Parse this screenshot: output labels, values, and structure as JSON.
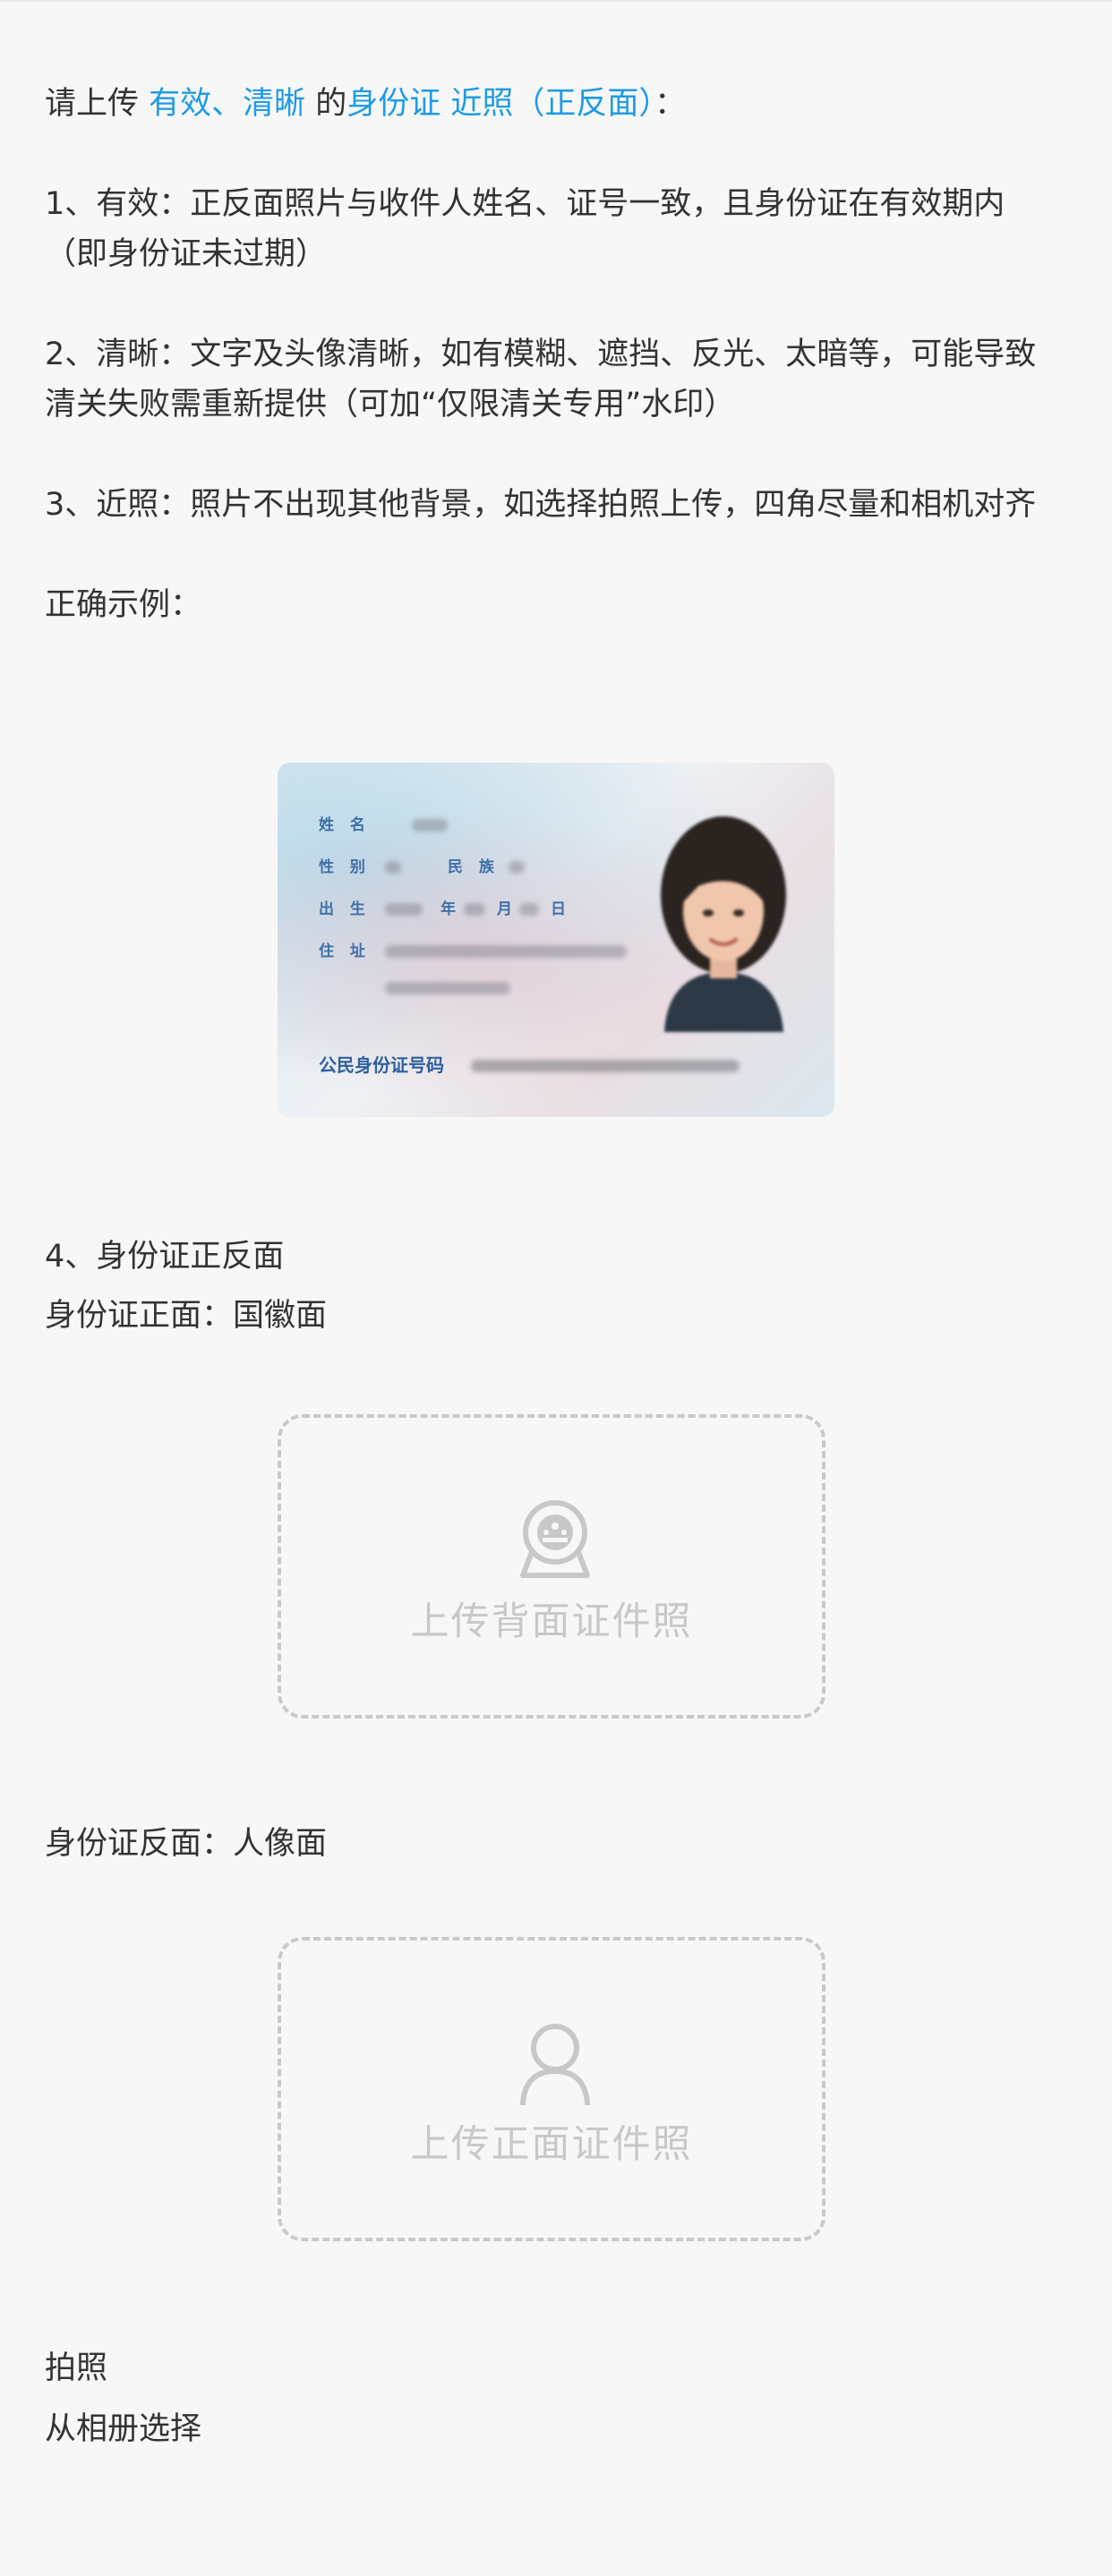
{
  "intro": {
    "prefix": "请上传 ",
    "highlight1": "有效、清晰",
    "middle": " 的",
    "highlight2": "身份证 近照（正反面）",
    "suffix": "："
  },
  "rules": [
    "1、有效：正反面照片与收件人姓名、证号一致，且身份证在有效期内（即身份证未过期）",
    "2、清晰：文字及头像清晰，如有模糊、遮挡、反光、太暗等，可能导致清关失败需重新提供（可加“仅限清关专用”水印）",
    "3、近照：照片不出现其他背景，如选择拍照上传，四角尽量和相机对齐"
  ],
  "example_label": "正确示例：",
  "sample_card": {
    "fields": [
      "姓 名",
      "性 别",
      "出 生",
      "住 址"
    ],
    "gender_label": "民 族",
    "birth_year_unit": "年",
    "birth_month_unit": "月",
    "birth_day_unit": "日",
    "id_label": "公民身份证号码"
  },
  "section4": {
    "heading": "4、身份证正反面",
    "front_label": "身份证正面：国徽面",
    "back_label": "身份证反面：人像面"
  },
  "uploads": {
    "emblem_side": {
      "label": "上传背面证件照",
      "icon": "emblem-badge-icon"
    },
    "portrait_side": {
      "label": "上传正面证件照",
      "icon": "person-icon"
    }
  },
  "actions": {
    "take_photo": "拍照",
    "choose_album": "从相册选择"
  },
  "colors": {
    "highlight": "#1d9be6",
    "text": "#333333",
    "placeholder": "#c8c8c8",
    "background": "#f7f7f7"
  }
}
